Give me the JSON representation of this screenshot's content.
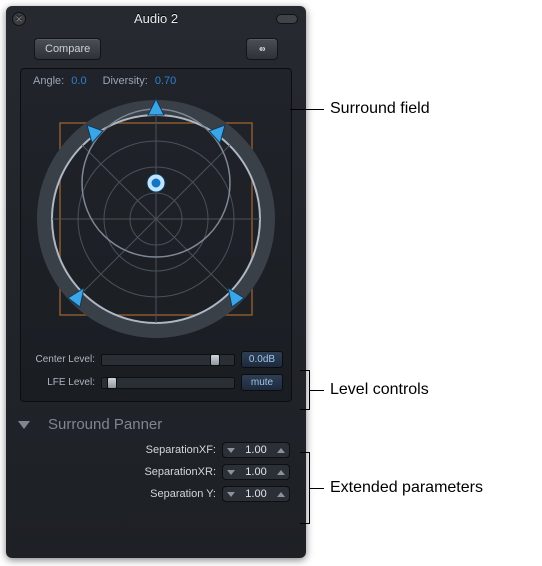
{
  "window": {
    "title": "Audio 2"
  },
  "toolbar": {
    "compare_label": "Compare"
  },
  "readouts": {
    "angle_label": "Angle:",
    "angle_value": "0.0",
    "diversity_label": "Diversity:",
    "diversity_value": "0.70"
  },
  "levels": {
    "center_label": "Center Level:",
    "center_readout": "0.0dB",
    "center_pos_pct": 82,
    "lfe_label": "LFE Level:",
    "lfe_btn": "mute",
    "lfe_pos_pct": 4
  },
  "section": {
    "title": "Surround Panner"
  },
  "params": [
    {
      "label": "SeparationXF:",
      "value": "1.00"
    },
    {
      "label": "SeparationXR:",
      "value": "1.00"
    },
    {
      "label": "Separation Y:",
      "value": "1.00"
    }
  ],
  "callouts": {
    "field": "Surround field",
    "levels": "Level controls",
    "extended": "Extended parameters"
  }
}
